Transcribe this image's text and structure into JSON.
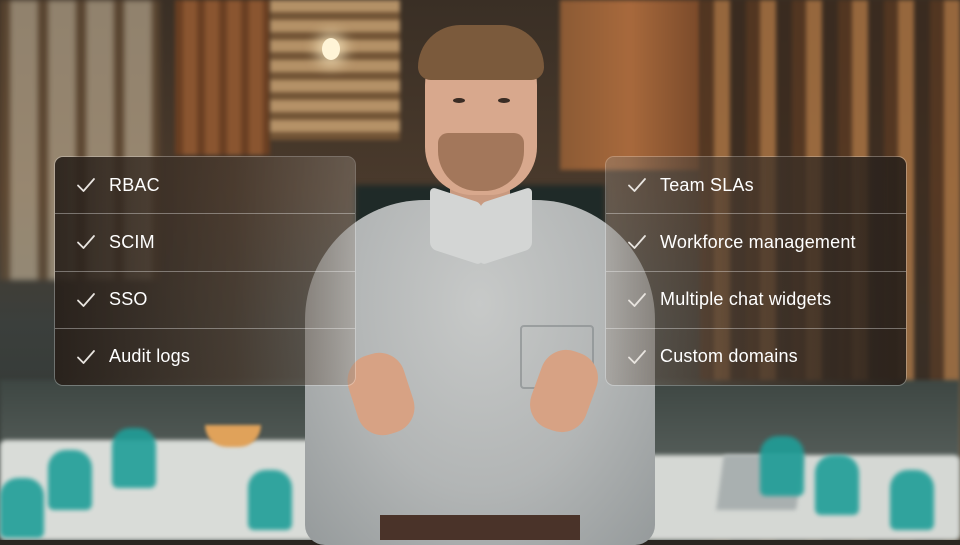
{
  "overlay": {
    "left_panel": {
      "items": [
        {
          "label": "RBAC"
        },
        {
          "label": "SCIM"
        },
        {
          "label": "SSO"
        },
        {
          "label": "Audit logs"
        }
      ]
    },
    "right_panel": {
      "items": [
        {
          "label": "Team SLAs"
        },
        {
          "label": "Workforce management"
        },
        {
          "label": "Multiple chat widgets"
        },
        {
          "label": "Custom domains"
        }
      ]
    }
  },
  "icons": {
    "item_icon": "check-icon"
  },
  "colors": {
    "text": "#ffffff",
    "panel_dark": "#28201a",
    "chair_teal": "#1f9e98"
  }
}
